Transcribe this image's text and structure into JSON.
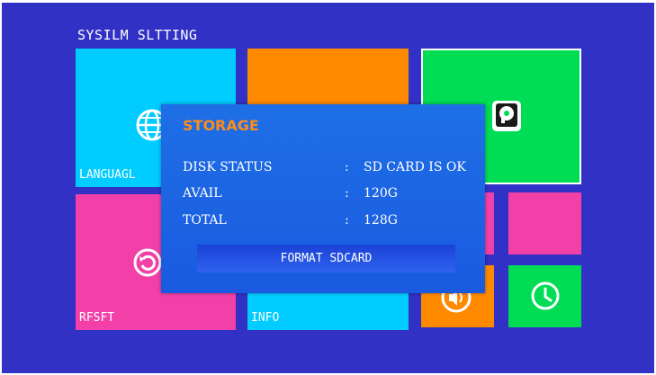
{
  "header": {
    "title": "SYSILM SLTTING"
  },
  "tiles": {
    "language": {
      "label": "LANGUAGL",
      "icon": "globe-icon",
      "color": "#00ccff"
    },
    "orange_top": {
      "color": "#ff8a00"
    },
    "storage": {
      "icon": "hard-disk-icon",
      "color": "#00dd55"
    },
    "reset": {
      "label": "RFSFT",
      "icon": "restore-icon",
      "color": "#f240a8"
    },
    "info": {
      "label": "INFO",
      "color": "#00ccff"
    },
    "pink_small_a": {
      "color": "#f240a8"
    },
    "pink_small_b": {
      "color": "#f240a8"
    },
    "volume": {
      "icon": "speaker-icon",
      "color": "#ff8a00"
    },
    "clock": {
      "icon": "clock-icon",
      "color": "#00dd55"
    }
  },
  "dialog": {
    "title": "STORAGE",
    "rows": [
      {
        "key": "DISK STATUS",
        "sep": ":",
        "value": "SD CARD IS OK"
      },
      {
        "key": "AVAIL",
        "sep": ":",
        "value": "120G"
      },
      {
        "key": "TOTAL",
        "sep": ":",
        "value": "128G"
      }
    ],
    "format_label": "FORMAT SDCARD"
  }
}
